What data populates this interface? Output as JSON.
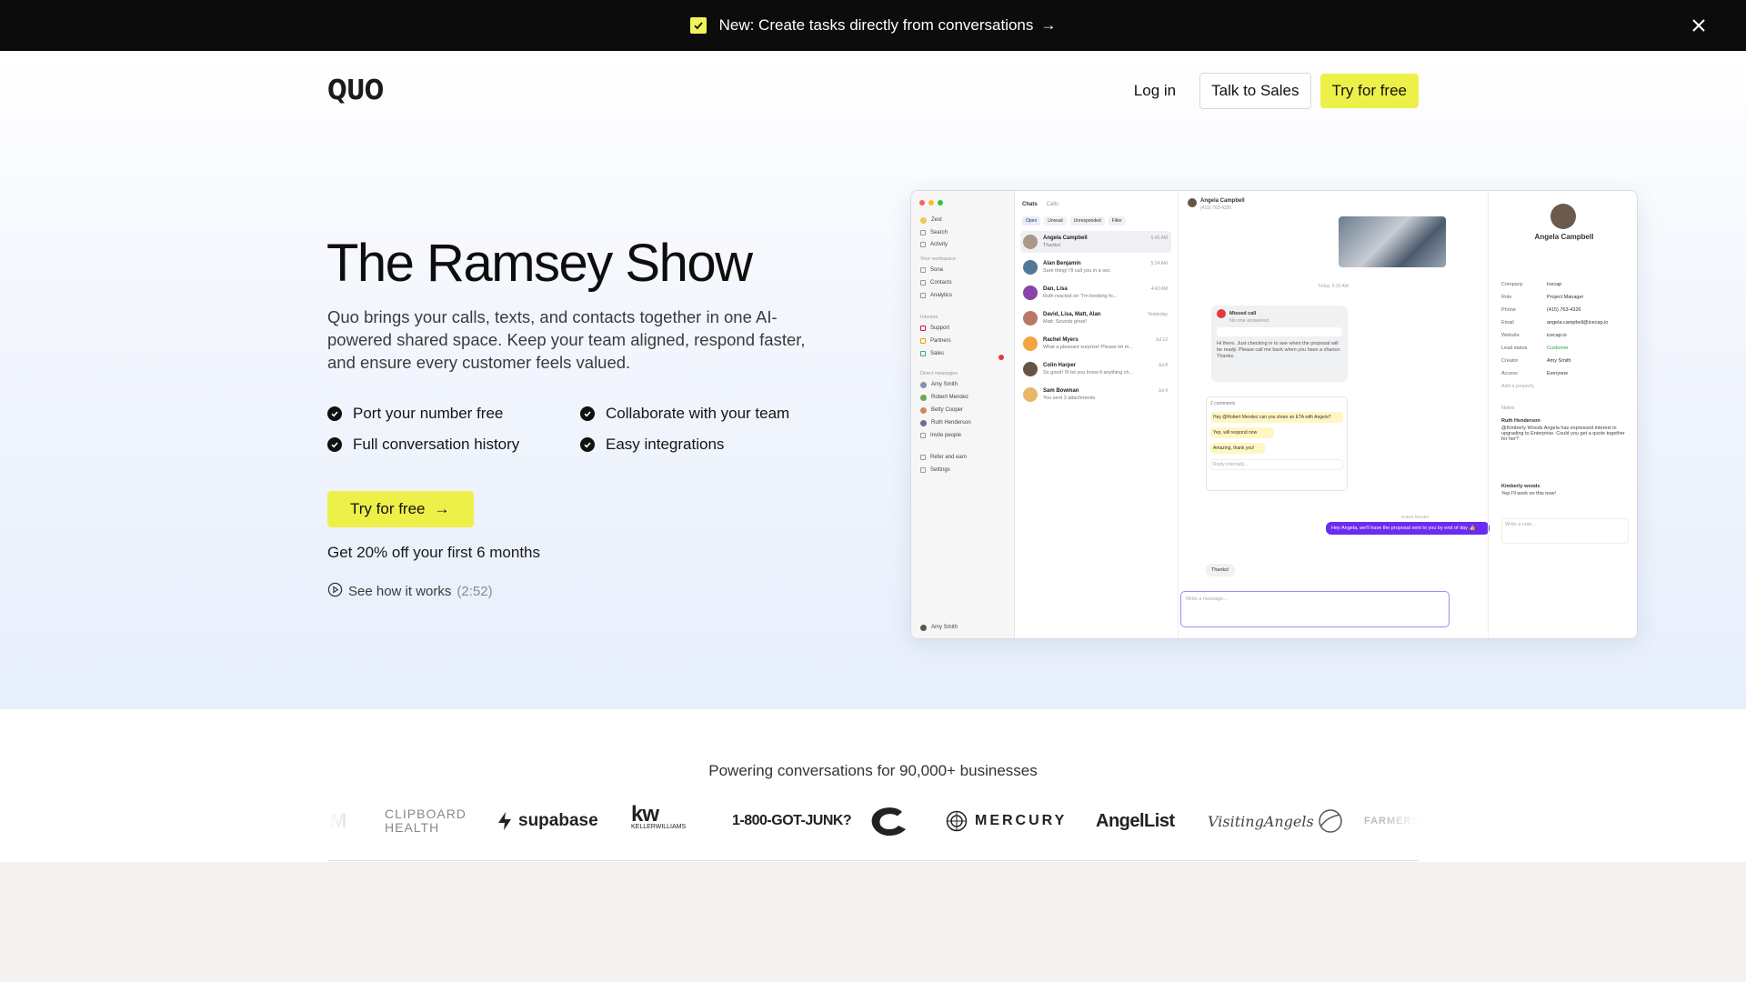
{
  "announcement": {
    "text": "New: Create tasks directly from conversations",
    "arrow": "→",
    "check_color": "#f2f25a"
  },
  "nav": {
    "logo": "QUO",
    "login": "Log in",
    "talk_to_sales": "Talk to Sales",
    "try_free": "Try for free"
  },
  "hero": {
    "title": "The Ramsey Show",
    "description": "Quo brings your calls, texts, and contacts together in one AI-powered shared space. Keep your team aligned, respond faster, and ensure every customer feels valued.",
    "features": [
      {
        "label": "Port your number free"
      },
      {
        "label": "Collaborate with your team"
      },
      {
        "label": "Full conversation history"
      },
      {
        "label": "Easy integrations"
      }
    ],
    "cta": "Try for free",
    "cta_arrow": "→",
    "discount": "Get 20% off your first 6 months",
    "how_it_works": "See how it works",
    "duration": "(2:52)",
    "accent_color": "#eef04a"
  },
  "app_preview": {
    "sidebar": {
      "workspace": "Zest",
      "search": "Search",
      "activity": "Activity",
      "your_workspace": "Your workspace",
      "items": [
        "Sona",
        "Contacts",
        "Analytics"
      ],
      "inboxes_head": "Inboxes",
      "inboxes": [
        "Support",
        "Partners",
        "Sales"
      ],
      "dm_head": "Direct messages",
      "dms": [
        "Amy Smith",
        "Robert Mendez",
        "Betty Cooper",
        "Ruth Henderson",
        "Invite people"
      ],
      "footer": [
        "Refer and earn",
        "Settings"
      ],
      "user": "Amy Smith"
    },
    "list": {
      "tabs": [
        "Chats",
        "Calls"
      ],
      "filters": [
        "Open",
        "Unread",
        "Unresponded",
        "Filter"
      ],
      "chats": [
        {
          "name": "Angela Campbell",
          "preview": "Thanks!",
          "time": "5:45 AM"
        },
        {
          "name": "Alan Benjamin",
          "preview": "Sure thing! I'll call you in a sec",
          "time": "5:34 AM"
        },
        {
          "name": "Dan, Lisa",
          "preview": "Ruth reacted on \"I'm booking fo...",
          "time": "4:42 AM"
        },
        {
          "name": "David, Lisa, Matt, Alan",
          "preview": "Matt: Sounds great!",
          "time": "Yesterday"
        },
        {
          "name": "Rachel Myers",
          "preview": "What a pleasant surprise! Please let m...",
          "time": "Jul 12"
        },
        {
          "name": "Colin Harper",
          "preview": "So good! I'll let you know if anything ch...",
          "time": "Jul 8"
        },
        {
          "name": "Sam Bowman",
          "preview": "You sent 3 attachments",
          "time": "Jul 4"
        }
      ]
    },
    "conversation": {
      "contact": "Angela Campbell",
      "phone": "(415) 763-4326",
      "date": "Today, 9:26 AM",
      "missed_call": "Missed call",
      "no_answer": "No one answered",
      "voicemail": "Hi there. Just checking in to see when the proposal will be ready. Please call me back when you have a chance. Thanks.",
      "thread_count": "2 comments",
      "thread_msg_1": "Hey @Robert Mendez can you share an ETA with Angela?",
      "thread_msg_2": "Yep, will respond now",
      "thread_msg_3": "Amazing, thank you!",
      "reply_placeholder": "Reply internally...",
      "sender": "Robert Mendez",
      "outgoing": "Hey Angela, we'll have the proposal sent to you by end of day 👍",
      "incoming": "Thanks!",
      "composer_placeholder": "Write a message..."
    },
    "details": {
      "name": "Angela Campbell",
      "properties": [
        {
          "k": "Company",
          "v": "Icecap"
        },
        {
          "k": "Role",
          "v": "Project Manager"
        },
        {
          "k": "Phone",
          "v": "(415) 763-4326"
        },
        {
          "k": "Email",
          "v": "angela.campbell@icecap.io"
        },
        {
          "k": "Website",
          "v": "icecap.io"
        },
        {
          "k": "Lead status",
          "v": "Customer"
        },
        {
          "k": "Creator",
          "v": "Amy Smith"
        },
        {
          "k": "Access",
          "v": "Everyone"
        }
      ],
      "add_property": "Add a property",
      "notes_head": "Notes",
      "note_1_author": "Ruth Henderson",
      "note_1_text": "@Kimberly Woods Angela has expressed interest in upgrading to Enterprise. Could you get a quote together for her?",
      "note_2_author": "Kimberly woods",
      "note_2_text": "Yep I'll work on this now!",
      "note_placeholder": "Write a note..."
    }
  },
  "logos": {
    "heading": "Powering conversations for 90,000+ businesses",
    "items": [
      "CLIPBOARD",
      "HEALTH",
      "supabase",
      "kw",
      "KELLERWILLIAMS",
      "1-800-GOT-JUNK?",
      "MERCURY",
      "AngelList",
      "VisitingAngels",
      "FARMERS"
    ]
  }
}
